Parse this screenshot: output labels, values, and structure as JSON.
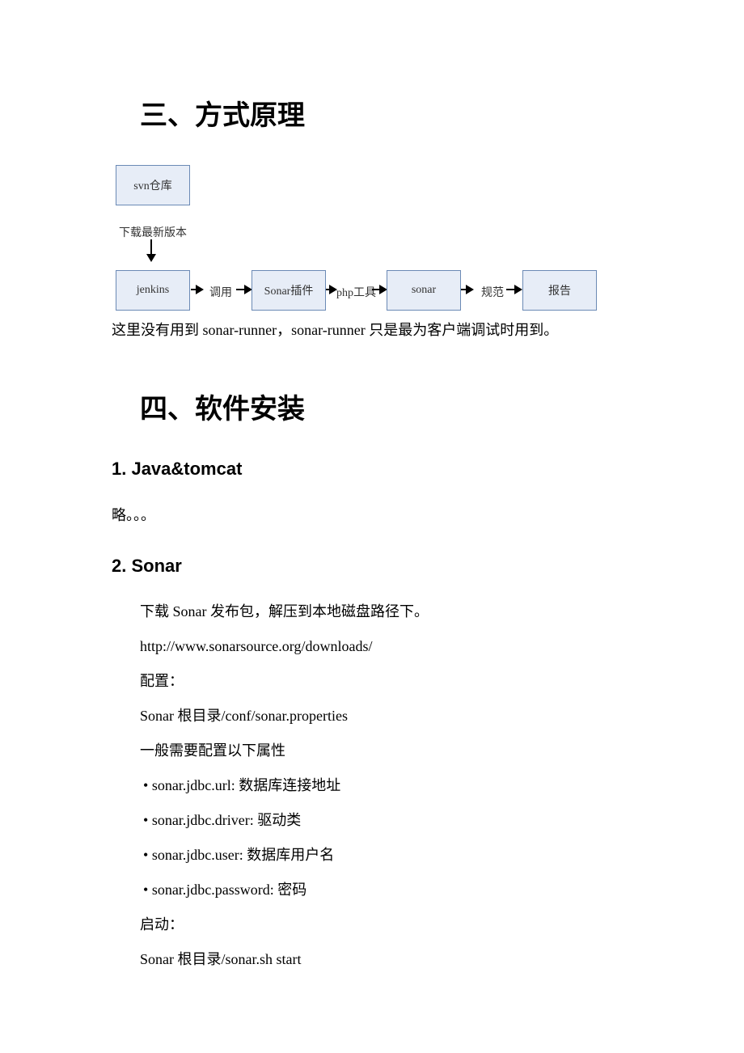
{
  "section3": {
    "heading": "三、方式原理",
    "diagram": {
      "boxes": {
        "svn": "svn仓库",
        "jenkins": "jenkins",
        "sonarPlugin": "Sonar插件",
        "sonar": "sonar",
        "report": "报告"
      },
      "arrows": {
        "download": "下载最新版本",
        "call": "调用",
        "php": "php工具",
        "spec": "规范"
      }
    },
    "note": "这里没有用到 sonar-runner，sonar-runner 只是最为客户端调试时用到。"
  },
  "section4": {
    "heading": "四、软件安装",
    "sub1": {
      "heading": "1.  Java&tomcat",
      "body": "略。。。"
    },
    "sub2": {
      "heading": "2.  Sonar",
      "lines": {
        "download": "下载  Sonar  发布包，解压到本地磁盘路径下。",
        "url": "http://www.sonarsource.org/downloads/",
        "config": "配置：",
        "conf_path": "Sonar 根目录/conf/sonar.properties",
        "need": "一般需要配置以下属性",
        "b1": "sonar.jdbc.url:  数据库连接地址",
        "b2": "sonar.jdbc.driver:  驱动类",
        "b3": "sonar.jdbc.user:  数据库用户名",
        "b4": "sonar.jdbc.password:  密码",
        "start": "启动：",
        "start_cmd": "Sonar 根目录/sonar.sh start"
      }
    }
  }
}
